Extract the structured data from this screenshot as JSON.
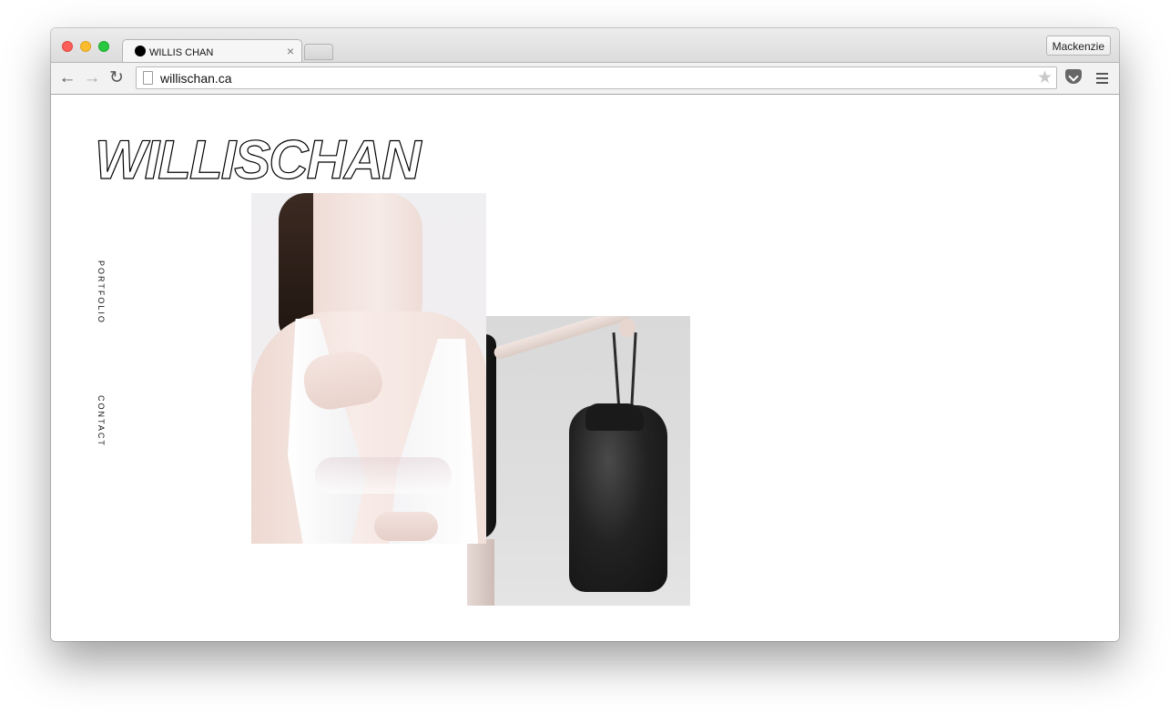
{
  "browser": {
    "tab_title": "WILLIS CHAN",
    "tab_close": "×",
    "profile": "Mackenzie",
    "url": "willischan.ca",
    "icons": {
      "back": "arrow-left-icon",
      "forward": "arrow-right-icon",
      "reload": "reload-icon",
      "bookmark": "star-icon",
      "pocket": "pocket-icon",
      "menu": "hamburger-menu-icon"
    }
  },
  "site": {
    "logo": "WILLISCHAN",
    "nav": {
      "portfolio": "PORTFOLIO",
      "contact": "CONTACT"
    }
  }
}
